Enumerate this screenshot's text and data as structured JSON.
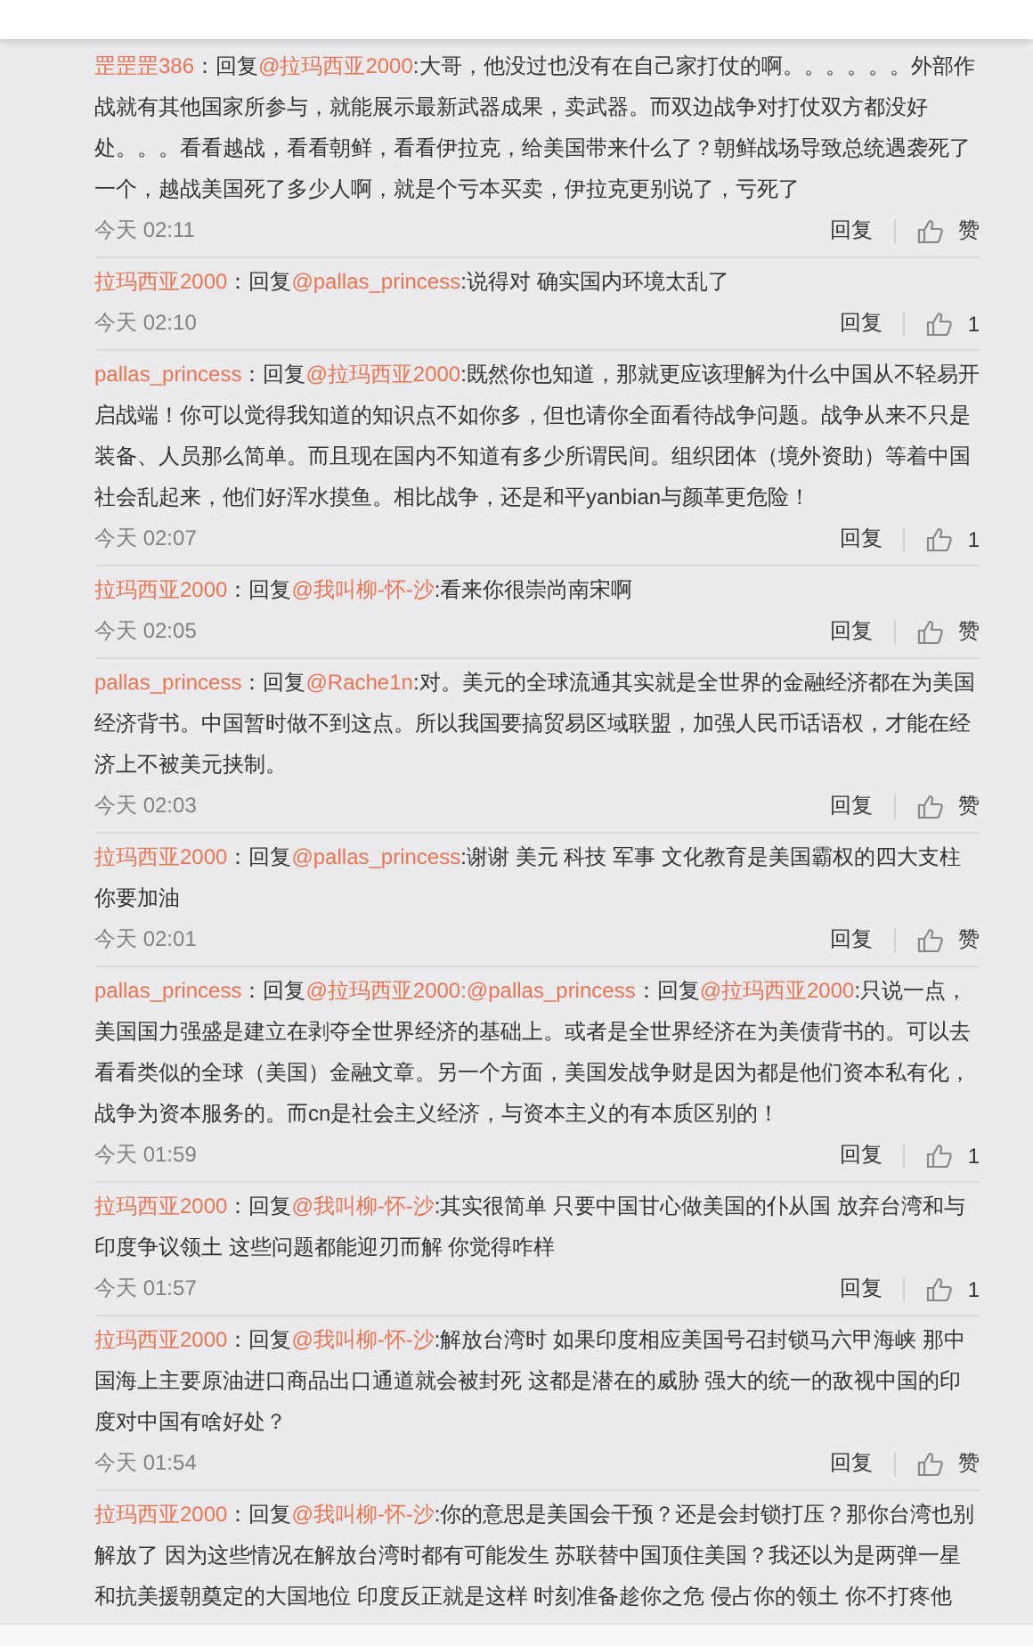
{
  "comments": [
    {
      "author": "罡罡罡386",
      "body": [
        {
          "kind": "text",
          "text": "：回复"
        },
        {
          "kind": "mention",
          "text": "@拉玛西亚2000"
        },
        {
          "kind": "text",
          "text": ":大哥，他没过也没有在自己家打仗的啊。。。。。。外部作战就有其他国家所参与，就能展示最新武器成果，卖武器。而双边战争对打仗双方都没好处。。。看看越战，看看朝鲜，看看伊拉克，给美国带来什么了？朝鲜战场导致总统遇袭死了一个，越战美国死了多少人啊，就是个亏本买卖，伊拉克更别说了，亏死了"
        }
      ],
      "time": "今天 02:11",
      "reply": "回复",
      "likes": "赞"
    },
    {
      "author": "拉玛西亚2000",
      "body": [
        {
          "kind": "text",
          "text": "：回复"
        },
        {
          "kind": "mention",
          "text": "@pallas_princess"
        },
        {
          "kind": "text",
          "text": ":说得对 确实国内环境太乱了"
        }
      ],
      "time": "今天 02:10",
      "reply": "回复",
      "likes": "1"
    },
    {
      "author": "pallas_princess",
      "body": [
        {
          "kind": "text",
          "text": "：回复"
        },
        {
          "kind": "mention",
          "text": "@拉玛西亚2000"
        },
        {
          "kind": "text",
          "text": ":既然你也知道，那就更应该理解为什么中国从不轻易开启战端！你可以觉得我知道的知识点不如你多，但也请你全面看待战争问题。战争从来不只是装备、人员那么简单。而且现在国内不知道有多少所谓民间。组织团体（境外资助）等着中国社会乱起来，他们好浑水摸鱼。相比战争，还是和平yanbian与颜革更危险！"
        }
      ],
      "time": "今天 02:07",
      "reply": "回复",
      "likes": "1"
    },
    {
      "author": "拉玛西亚2000",
      "body": [
        {
          "kind": "text",
          "text": "：回复"
        },
        {
          "kind": "mention",
          "text": "@我叫柳-怀-沙"
        },
        {
          "kind": "text",
          "text": ":看来你很崇尚南宋啊"
        }
      ],
      "time": "今天 02:05",
      "reply": "回复",
      "likes": "赞"
    },
    {
      "author": "pallas_princess",
      "body": [
        {
          "kind": "text",
          "text": "：回复"
        },
        {
          "kind": "mention",
          "text": "@Rache1n"
        },
        {
          "kind": "text",
          "text": ":对。美元的全球流通其实就是全世界的金融经济都在为美国经济背书。中国暂时做不到这点。所以我国要搞贸易区域联盟，加强人民币话语权，才能在经济上不被美元挟制。"
        }
      ],
      "time": "今天 02:03",
      "reply": "回复",
      "likes": "赞"
    },
    {
      "author": "拉玛西亚2000",
      "body": [
        {
          "kind": "text",
          "text": "：回复"
        },
        {
          "kind": "mention",
          "text": "@pallas_princess"
        },
        {
          "kind": "text",
          "text": ":谢谢 美元 科技 军事 文化教育是美国霸权的四大支柱你要加油"
        }
      ],
      "time": "今天 02:01",
      "reply": "回复",
      "likes": "赞"
    },
    {
      "author": "pallas_princess",
      "body": [
        {
          "kind": "text",
          "text": "：回复"
        },
        {
          "kind": "mention",
          "text": "@拉玛西亚2000:@pallas_princess"
        },
        {
          "kind": "text",
          "text": "：回复"
        },
        {
          "kind": "mention",
          "text": "@拉玛西亚2000"
        },
        {
          "kind": "text",
          "text": ":只说一点，美国国力强盛是建立在剥夺全世界经济的基础上。或者是全世界经济在为美债背书的。可以去看看类似的全球（美国）金融文章。另一个方面，美国发战争财是因为都是他们资本私有化，战争为资本服务的。而cn是社会主义经济，与资本主义的有本质区别的！"
        }
      ],
      "time": "今天 01:59",
      "reply": "回复",
      "likes": "1"
    },
    {
      "author": "拉玛西亚2000",
      "body": [
        {
          "kind": "text",
          "text": "：回复"
        },
        {
          "kind": "mention",
          "text": "@我叫柳-怀-沙"
        },
        {
          "kind": "text",
          "text": ":其实很简单 只要中国甘心做美国的仆从国 放弃台湾和与印度争议领土 这些问题都能迎刃而解 你觉得咋样"
        }
      ],
      "time": "今天 01:57",
      "reply": "回复",
      "likes": "1"
    },
    {
      "author": "拉玛西亚2000",
      "body": [
        {
          "kind": "text",
          "text": "：回复"
        },
        {
          "kind": "mention",
          "text": "@我叫柳-怀-沙"
        },
        {
          "kind": "text",
          "text": ":解放台湾时 如果印度相应美国号召封锁马六甲海峡  那中国海上主要原油进口商品出口通道就会被封死 这都是潜在的威胁 强大的统一的敌视中国的印度对中国有啥好处？"
        }
      ],
      "time": "今天 01:54",
      "reply": "回复",
      "likes": "赞"
    },
    {
      "author": "拉玛西亚2000",
      "body": [
        {
          "kind": "text",
          "text": "：回复"
        },
        {
          "kind": "mention",
          "text": "@我叫柳-怀-沙"
        },
        {
          "kind": "text",
          "text": ":你的意思是美国会干预？还是会封锁打压？那你台湾也别解放了  因为这些情况在解放台湾时都有可能发生 苏联替中国顶住美国？我还以为是两弹一星和抗美援朝奠定的大国地位  印度反正就是这样 时刻准备趁你之危 侵占你的领土 你不打疼他"
        }
      ]
    }
  ]
}
